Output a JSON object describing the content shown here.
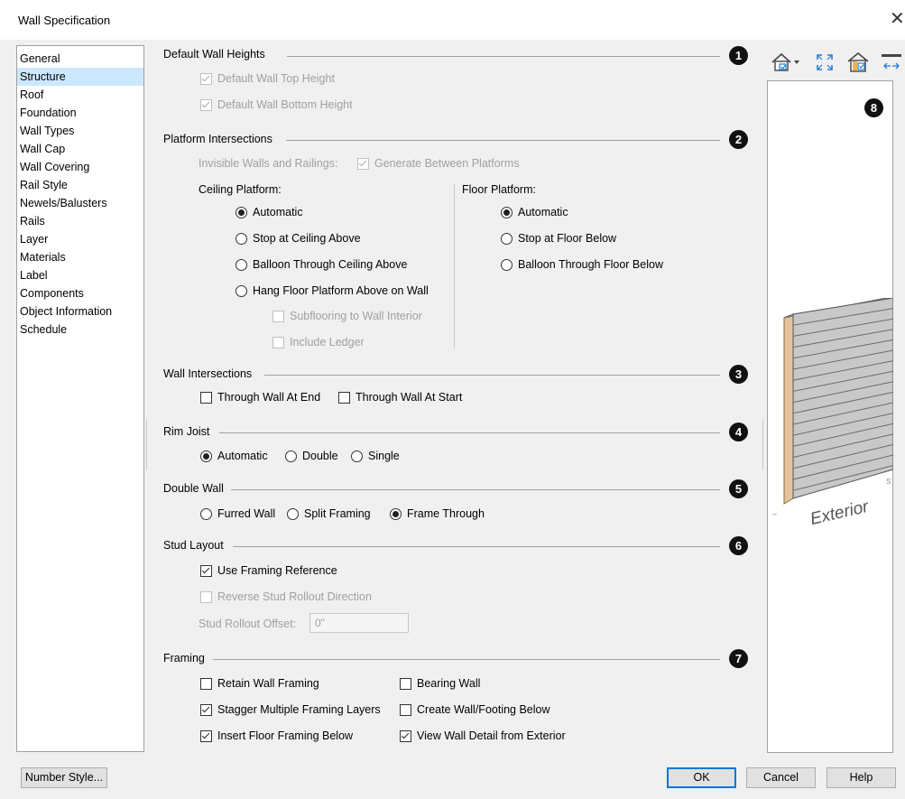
{
  "window": {
    "title": "Wall Specification",
    "close_glyph": "✕"
  },
  "sidebar": {
    "items": [
      {
        "label": "General",
        "selected": false
      },
      {
        "label": "Structure",
        "selected": true
      },
      {
        "label": "Roof",
        "selected": false
      },
      {
        "label": "Foundation",
        "selected": false
      },
      {
        "label": "Wall Types",
        "selected": false
      },
      {
        "label": "Wall Cap",
        "selected": false
      },
      {
        "label": "Wall Covering",
        "selected": false
      },
      {
        "label": "Rail Style",
        "selected": false
      },
      {
        "label": "Newels/Balusters",
        "selected": false
      },
      {
        "label": "Rails",
        "selected": false
      },
      {
        "label": "Layer",
        "selected": false
      },
      {
        "label": "Materials",
        "selected": false
      },
      {
        "label": "Label",
        "selected": false
      },
      {
        "label": "Components",
        "selected": false
      },
      {
        "label": "Object Information",
        "selected": false
      },
      {
        "label": "Schedule",
        "selected": false
      }
    ]
  },
  "callouts": [
    "1",
    "2",
    "3",
    "4",
    "5",
    "6",
    "7",
    "8"
  ],
  "default_heights": {
    "title": "Default Wall Heights",
    "top": {
      "label": "Default Wall Top Height",
      "checked": true,
      "disabled": true
    },
    "bottom": {
      "label": "Default Wall Bottom Height",
      "checked": true,
      "disabled": true
    }
  },
  "platform": {
    "title": "Platform Intersections",
    "invisible_label": "Invisible Walls and Railings:",
    "generate": {
      "label": "Generate Between Platforms",
      "checked": true,
      "disabled": true
    },
    "ceiling_title": "Ceiling Platform:",
    "ceiling_options": [
      "Automatic",
      "Stop at Ceiling Above",
      "Balloon Through Ceiling Above",
      "Hang Floor Platform Above on Wall"
    ],
    "ceiling_selected": "Automatic",
    "subflooring": {
      "label": "Subflooring to Wall Interior",
      "checked": false,
      "disabled": true
    },
    "ledger": {
      "label": "Include Ledger",
      "checked": false,
      "disabled": true
    },
    "floor_title": "Floor Platform:",
    "floor_options": [
      "Automatic",
      "Stop at Floor Below",
      "Balloon Through Floor Below"
    ],
    "floor_selected": "Automatic"
  },
  "wall_intersections": {
    "title": "Wall Intersections",
    "end": {
      "label": "Through Wall At End",
      "checked": false
    },
    "start": {
      "label": "Through Wall At Start",
      "checked": false
    }
  },
  "rim_joist": {
    "title": "Rim Joist",
    "options": [
      "Automatic",
      "Double",
      "Single"
    ],
    "selected": "Automatic"
  },
  "double_wall": {
    "title": "Double Wall",
    "options": [
      "Furred Wall",
      "Split Framing",
      "Frame Through"
    ],
    "selected": "Frame Through"
  },
  "stud_layout": {
    "title": "Stud Layout",
    "use_ref": {
      "label": "Use Framing Reference",
      "checked": true
    },
    "reverse": {
      "label": "Reverse Stud Rollout Direction",
      "checked": false,
      "disabled": true
    },
    "offset_label": "Stud Rollout Offset:",
    "offset_value": "0\""
  },
  "framing": {
    "title": "Framing",
    "retain": {
      "label": "Retain Wall Framing",
      "checked": false
    },
    "bearing": {
      "label": "Bearing Wall",
      "checked": false
    },
    "stagger": {
      "label": "Stagger Multiple Framing Layers",
      "checked": true
    },
    "create_footing": {
      "label": "Create Wall/Footing Below",
      "checked": false
    },
    "insert_floor": {
      "label": "Insert Floor Framing Below",
      "checked": true
    },
    "view_detail": {
      "label": "View Wall Detail from Exterior",
      "checked": true
    }
  },
  "preview": {
    "label": "Exterior",
    "side_e": "E",
    "side_s": "S"
  },
  "buttons": {
    "number_style": "Number Style...",
    "ok": "OK",
    "cancel": "Cancel",
    "help": "Help"
  },
  "colors": {
    "accent": "#0078d7",
    "selection": "#cce8ff",
    "wall_edge": "#e4c49a"
  }
}
